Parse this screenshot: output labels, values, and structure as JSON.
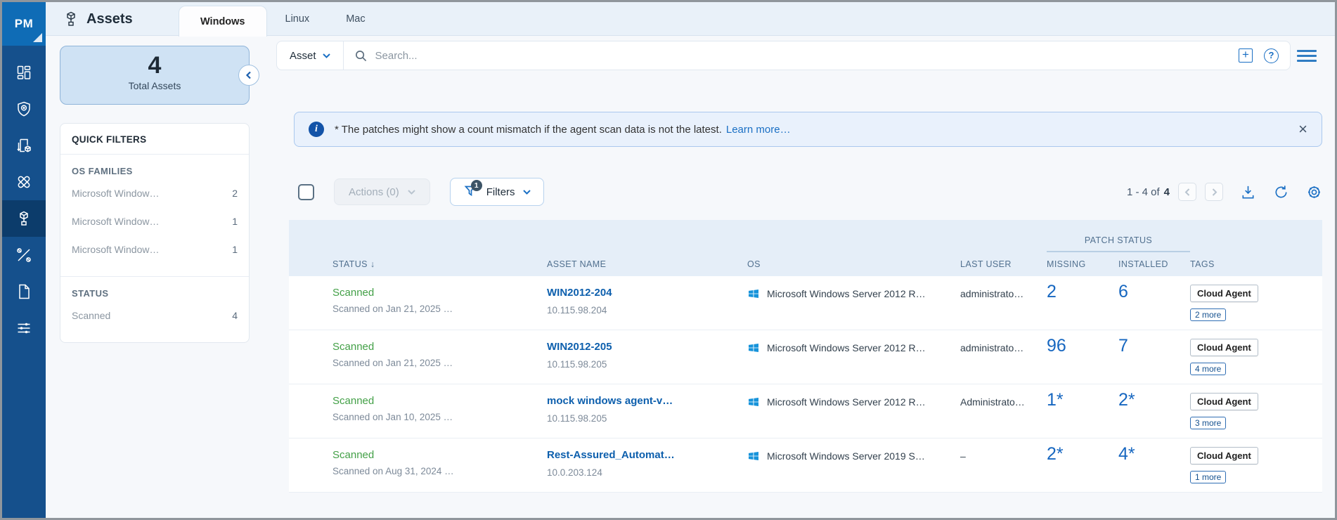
{
  "app": {
    "logo_text": "PM"
  },
  "sidebar": {
    "items": [
      {
        "icon": "dashboard-icon"
      },
      {
        "icon": "shield-icon"
      },
      {
        "icon": "jobs-icon"
      },
      {
        "icon": "patches-icon"
      },
      {
        "icon": "assets-icon",
        "active": true
      },
      {
        "icon": "tools-icon"
      },
      {
        "icon": "reports-icon"
      },
      {
        "icon": "configuration-icon"
      }
    ]
  },
  "header": {
    "title": "Assets",
    "tabs": [
      {
        "label": "Windows",
        "active": true
      },
      {
        "label": "Linux"
      },
      {
        "label": "Mac"
      }
    ]
  },
  "summary": {
    "count": "4",
    "label": "Total Assets"
  },
  "quick_filters": {
    "title": "QUICK FILTERS",
    "sections": [
      {
        "title": "OS FAMILIES",
        "items": [
          {
            "label": "Microsoft Window…",
            "count": "2"
          },
          {
            "label": "Microsoft Window…",
            "count": "1"
          },
          {
            "label": "Microsoft Window…",
            "count": "1"
          }
        ]
      },
      {
        "title": "STATUS",
        "items": [
          {
            "label": "Scanned",
            "count": "4"
          }
        ]
      }
    ]
  },
  "search": {
    "scope_label": "Asset",
    "placeholder": "Search..."
  },
  "banner": {
    "message": "* The patches might show a count mismatch if the agent scan data is not the latest.",
    "link_label": "Learn more…"
  },
  "toolbar": {
    "actions_label": "Actions (0)",
    "filters_label": "Filters",
    "filters_badge": "1",
    "pagination_range": "1 - 4 of",
    "pagination_total": "4"
  },
  "table": {
    "group_header": "PATCH STATUS",
    "sort_arrow": "↓",
    "columns": {
      "status": "STATUS",
      "asset_name": "ASSET NAME",
      "os": "OS",
      "last_user": "LAST USER",
      "missing": "MISSING",
      "installed": "INSTALLED",
      "tags": "TAGS"
    },
    "rows": [
      {
        "status": "Scanned",
        "status_detail": "Scanned on Jan 21, 2025 …",
        "name": "WIN2012-204",
        "ip": "10.115.98.204",
        "os": "Microsoft Windows Server 2012 R…",
        "last_user": "administrato…",
        "missing": "2",
        "installed": "6",
        "tag": "Cloud Agent",
        "more": "2 more"
      },
      {
        "status": "Scanned",
        "status_detail": "Scanned on Jan 21, 2025 …",
        "name": "WIN2012-205",
        "ip": "10.115.98.205",
        "os": "Microsoft Windows Server 2012 R…",
        "last_user": "administrato…",
        "missing": "96",
        "installed": "7",
        "tag": "Cloud Agent",
        "more": "4 more"
      },
      {
        "status": "Scanned",
        "status_detail": "Scanned on Jan 10, 2025 …",
        "name": "mock windows agent-v…",
        "ip": "10.115.98.205",
        "os": "Microsoft Windows Server 2012 R…",
        "last_user": "Administrato…",
        "missing": "1*",
        "installed": "2*",
        "tag": "Cloud Agent",
        "more": "3 more"
      },
      {
        "status": "Scanned",
        "status_detail": "Scanned on Aug 31, 2024 …",
        "name": "Rest-Assured_Automat…",
        "ip": "10.0.203.124",
        "os": "Microsoft Windows Server 2019 S…",
        "last_user": "–",
        "missing": "2*",
        "installed": "4*",
        "tag": "Cloud Agent",
        "more": "1 more"
      }
    ]
  },
  "colors": {
    "accent_blue": "#1a6fc4",
    "link_blue": "#0d5fad",
    "status_green": "#43a047",
    "sidebar_navy": "#15508c",
    "windows_logo_blue": "#1793da",
    "banner_bg": "#e9f1fc",
    "table_header_bg": "#e5eef8"
  }
}
